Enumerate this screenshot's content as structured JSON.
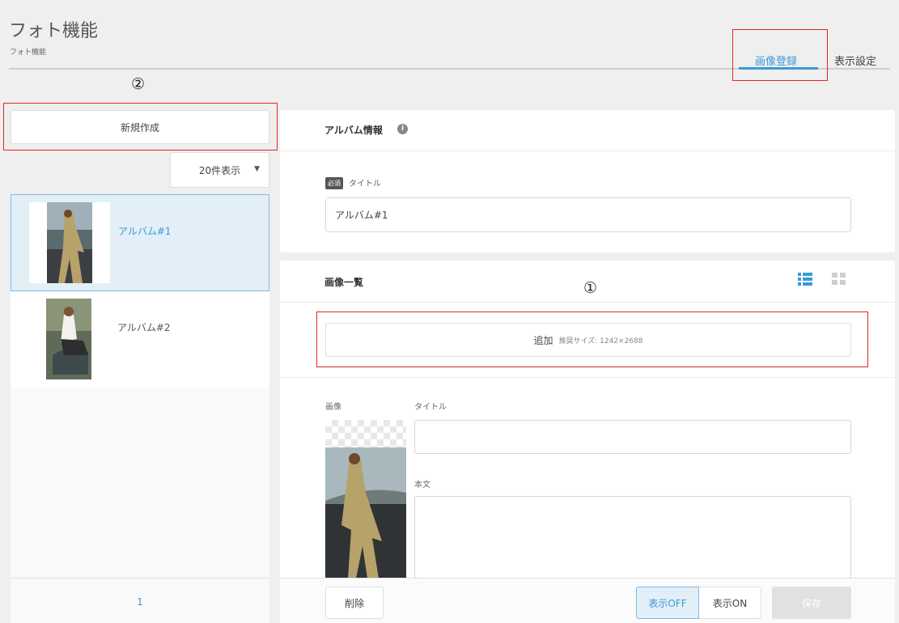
{
  "header": {
    "title": "フォト機能",
    "breadcrumb": "フォト機能",
    "tabs": [
      {
        "label": "画像登録",
        "active": true
      },
      {
        "label": "表示設定",
        "active": false
      }
    ]
  },
  "annotations": {
    "marker_1": "①",
    "marker_2": "②",
    "highlight_color": "#e0262a"
  },
  "sidebar": {
    "new_button": "新規作成",
    "page_size": {
      "selected": "20件表示"
    },
    "albums": [
      {
        "name": "アルバム#1",
        "selected": true
      },
      {
        "name": "アルバム#2",
        "selected": false
      }
    ],
    "pagination": {
      "current": "1"
    }
  },
  "album_info": {
    "title": "アルバム情報",
    "info_icon": "i",
    "required_badge": "必須",
    "title_label": "タイトル",
    "title_value": "アルバム#1"
  },
  "images": {
    "title": "画像一覧",
    "view_icons": [
      "list-view-icon",
      "grid-view-icon"
    ],
    "add_button": "追加",
    "add_hint": "推奨サイズ: 1242×2688",
    "image_label": "画像",
    "title_label": "タイトル",
    "body_label": "本文"
  },
  "footer": {
    "delete": "削除",
    "display_off": "表示OFF",
    "display_on": "表示ON",
    "save": "保存"
  },
  "colors": {
    "accent": "#3a9ad9",
    "background": "#efefef"
  }
}
